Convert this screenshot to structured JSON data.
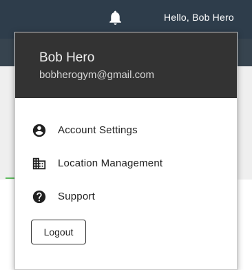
{
  "header": {
    "greeting": "Hello, Bob Hero",
    "bell_icon": "bell-icon"
  },
  "user_menu": {
    "name": "Bob Hero",
    "email": "bobherogym@gmail.com",
    "items": [
      {
        "label": "Account Settings",
        "icon": "account-circle-icon"
      },
      {
        "label": "Location Management",
        "icon": "building-icon"
      },
      {
        "label": "Support",
        "icon": "help-circle-icon"
      }
    ],
    "logout_label": "Logout"
  },
  "colors": {
    "topbar": "#2e3d4b",
    "dropdown_header": "#333333",
    "accent_green": "#5dbb5d"
  }
}
